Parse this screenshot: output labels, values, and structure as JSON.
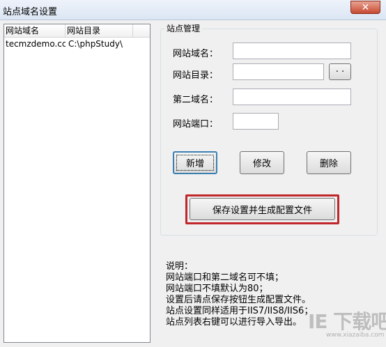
{
  "window": {
    "title": "站点域名设置",
    "close_symbol": "✕"
  },
  "site_list": {
    "columns": [
      "网站域名",
      "网站目录"
    ],
    "rows": [
      [
        "tecmzdemo.cc",
        "C:\\phpStudy\\"
      ]
    ]
  },
  "site_management": {
    "group_title": "站点管理",
    "domain_label": "网站域名：",
    "domain_value": "",
    "directory_label": "网站目录：",
    "directory_value": "",
    "browse_label": "· ·",
    "second_domain_label": "第二域名：",
    "second_domain_value": "",
    "port_label": "网站端口：",
    "port_value": "",
    "add_label": "新增",
    "modify_label": "修改",
    "delete_label": "删除",
    "save_label": "保存设置并生成配置文件"
  },
  "notes": {
    "heading": "说明：",
    "lines": [
      "网站端口和第二域名可不填；",
      "网站端口不填默认为80；",
      "设置后请点保存按钮生成配置文件。",
      "站点设置同样适用于IIS7/IIS8/IIS6；",
      "站点列表右键可以进行导入导出。"
    ]
  },
  "watermark": {
    "text": "IE 下载吧",
    "sub": "www.xiazaiba.com"
  },
  "colors": {
    "highlight": "#c0262a",
    "default_button_border": "#3c7fb1",
    "close_button": "#c74a31"
  }
}
